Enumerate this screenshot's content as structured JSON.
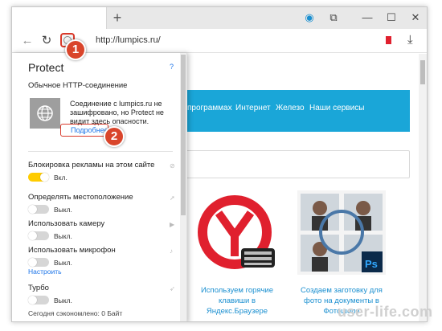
{
  "browser": {
    "url": "http://lumpics.ru/",
    "new_tab_icon": "plus-icon",
    "titlebar_icons": [
      "globe-indicator-icon",
      "copy-icon",
      "minimize-icon",
      "maximize-icon",
      "close-icon"
    ]
  },
  "page": {
    "menu": [
      "программах",
      "Интернет",
      "Железо",
      "Наши сервисы"
    ],
    "cards": [
      {
        "title": "Используем горячие клавиши в Яндекс.Браузере"
      },
      {
        "title": "Создаем заготовку для фото на документы в Фотошопе"
      }
    ]
  },
  "protect": {
    "title": "Protect",
    "help": "?",
    "connection": "Обычное HTTP-соединение",
    "description": "Соединение с lumpics.ru не зашифровано, но Protect не видит здесь опасности.",
    "more_link": "Подробнее",
    "settings": [
      {
        "label": "Блокировка рекламы на этом сайте",
        "state": "Вкл.",
        "on": true
      },
      {
        "label": "Определять местоположение",
        "state": "Выкл.",
        "on": false
      },
      {
        "label": "Использовать камеру",
        "state": "Выкл.",
        "on": false
      },
      {
        "label": "Использовать микрофон",
        "state": "Выкл.",
        "on": false
      },
      {
        "label": "Турбо",
        "state": "Выкл.",
        "on": false
      }
    ],
    "configure_link": "Настроить",
    "saved": "Сегодня сэкономлено: 0 Байт"
  },
  "callouts": [
    "1",
    "2"
  ],
  "watermark": "user-life.com",
  "colors": {
    "accent": "#1aa6d8",
    "toggle_on": "#ffcc00",
    "callout": "#d9452b",
    "link": "#1a73e8"
  }
}
